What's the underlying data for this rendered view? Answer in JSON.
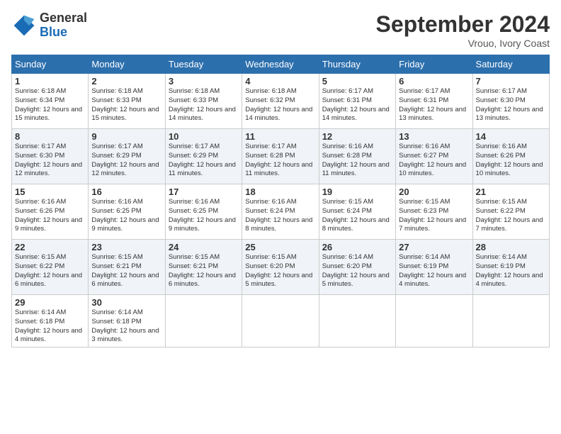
{
  "header": {
    "logo_general": "General",
    "logo_blue": "Blue",
    "month_title": "September 2024",
    "location": "Vrouo, Ivory Coast"
  },
  "days_of_week": [
    "Sunday",
    "Monday",
    "Tuesday",
    "Wednesday",
    "Thursday",
    "Friday",
    "Saturday"
  ],
  "weeks": [
    [
      {
        "day": "1",
        "sunrise": "6:18 AM",
        "sunset": "6:34 PM",
        "daylight": "12 hours and 15 minutes."
      },
      {
        "day": "2",
        "sunrise": "6:18 AM",
        "sunset": "6:33 PM",
        "daylight": "12 hours and 15 minutes."
      },
      {
        "day": "3",
        "sunrise": "6:18 AM",
        "sunset": "6:33 PM",
        "daylight": "12 hours and 14 minutes."
      },
      {
        "day": "4",
        "sunrise": "6:18 AM",
        "sunset": "6:32 PM",
        "daylight": "12 hours and 14 minutes."
      },
      {
        "day": "5",
        "sunrise": "6:17 AM",
        "sunset": "6:31 PM",
        "daylight": "12 hours and 14 minutes."
      },
      {
        "day": "6",
        "sunrise": "6:17 AM",
        "sunset": "6:31 PM",
        "daylight": "12 hours and 13 minutes."
      },
      {
        "day": "7",
        "sunrise": "6:17 AM",
        "sunset": "6:30 PM",
        "daylight": "12 hours and 13 minutes."
      }
    ],
    [
      {
        "day": "8",
        "sunrise": "6:17 AM",
        "sunset": "6:30 PM",
        "daylight": "12 hours and 12 minutes."
      },
      {
        "day": "9",
        "sunrise": "6:17 AM",
        "sunset": "6:29 PM",
        "daylight": "12 hours and 12 minutes."
      },
      {
        "day": "10",
        "sunrise": "6:17 AM",
        "sunset": "6:29 PM",
        "daylight": "12 hours and 11 minutes."
      },
      {
        "day": "11",
        "sunrise": "6:17 AM",
        "sunset": "6:28 PM",
        "daylight": "12 hours and 11 minutes."
      },
      {
        "day": "12",
        "sunrise": "6:16 AM",
        "sunset": "6:28 PM",
        "daylight": "12 hours and 11 minutes."
      },
      {
        "day": "13",
        "sunrise": "6:16 AM",
        "sunset": "6:27 PM",
        "daylight": "12 hours and 10 minutes."
      },
      {
        "day": "14",
        "sunrise": "6:16 AM",
        "sunset": "6:26 PM",
        "daylight": "12 hours and 10 minutes."
      }
    ],
    [
      {
        "day": "15",
        "sunrise": "6:16 AM",
        "sunset": "6:26 PM",
        "daylight": "12 hours and 9 minutes."
      },
      {
        "day": "16",
        "sunrise": "6:16 AM",
        "sunset": "6:25 PM",
        "daylight": "12 hours and 9 minutes."
      },
      {
        "day": "17",
        "sunrise": "6:16 AM",
        "sunset": "6:25 PM",
        "daylight": "12 hours and 9 minutes."
      },
      {
        "day": "18",
        "sunrise": "6:16 AM",
        "sunset": "6:24 PM",
        "daylight": "12 hours and 8 minutes."
      },
      {
        "day": "19",
        "sunrise": "6:15 AM",
        "sunset": "6:24 PM",
        "daylight": "12 hours and 8 minutes."
      },
      {
        "day": "20",
        "sunrise": "6:15 AM",
        "sunset": "6:23 PM",
        "daylight": "12 hours and 7 minutes."
      },
      {
        "day": "21",
        "sunrise": "6:15 AM",
        "sunset": "6:22 PM",
        "daylight": "12 hours and 7 minutes."
      }
    ],
    [
      {
        "day": "22",
        "sunrise": "6:15 AM",
        "sunset": "6:22 PM",
        "daylight": "12 hours and 6 minutes."
      },
      {
        "day": "23",
        "sunrise": "6:15 AM",
        "sunset": "6:21 PM",
        "daylight": "12 hours and 6 minutes."
      },
      {
        "day": "24",
        "sunrise": "6:15 AM",
        "sunset": "6:21 PM",
        "daylight": "12 hours and 6 minutes."
      },
      {
        "day": "25",
        "sunrise": "6:15 AM",
        "sunset": "6:20 PM",
        "daylight": "12 hours and 5 minutes."
      },
      {
        "day": "26",
        "sunrise": "6:14 AM",
        "sunset": "6:20 PM",
        "daylight": "12 hours and 5 minutes."
      },
      {
        "day": "27",
        "sunrise": "6:14 AM",
        "sunset": "6:19 PM",
        "daylight": "12 hours and 4 minutes."
      },
      {
        "day": "28",
        "sunrise": "6:14 AM",
        "sunset": "6:19 PM",
        "daylight": "12 hours and 4 minutes."
      }
    ],
    [
      {
        "day": "29",
        "sunrise": "6:14 AM",
        "sunset": "6:18 PM",
        "daylight": "12 hours and 4 minutes."
      },
      {
        "day": "30",
        "sunrise": "6:14 AM",
        "sunset": "6:18 PM",
        "daylight": "12 hours and 3 minutes."
      },
      null,
      null,
      null,
      null,
      null
    ]
  ]
}
